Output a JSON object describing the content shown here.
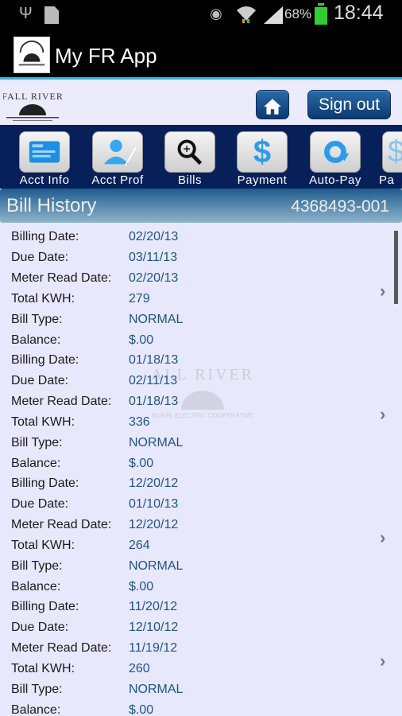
{
  "status_bar": {
    "icons": [
      "usb-icon",
      "no-sim-icon",
      "eye-icon",
      "wifi-icon",
      "signal-icon",
      "battery-charging-icon"
    ],
    "battery_percent": "68%",
    "time": "18:44"
  },
  "action_bar": {
    "title": "My FR App"
  },
  "header": {
    "logo_text": "FALL RIVER",
    "logo_subtext": "RURAL ELECTRIC COOPERATIVE",
    "home_icon": "home-icon",
    "sign_out_label": "Sign out"
  },
  "nav": {
    "items": [
      {
        "label": "Acct Info",
        "icon": "id-card-icon"
      },
      {
        "label": "Acct Prof",
        "icon": "user-profile-icon"
      },
      {
        "label": "Bills",
        "icon": "magnify-document-icon"
      },
      {
        "label": "Payment",
        "icon": "dollar-icon"
      },
      {
        "label": "Auto-Pay",
        "icon": "refresh-icon"
      },
      {
        "label": "Pa",
        "icon": "payment-partial-icon"
      }
    ]
  },
  "section": {
    "title": "Bill History",
    "account_number": "4368493-001"
  },
  "field_labels": {
    "billing_date": "Billing Date:",
    "due_date": "Due Date:",
    "meter_read_date": "Meter Read Date:",
    "total_kwh": "Total KWH:",
    "bill_type": "Bill Type:",
    "balance": "Balance:"
  },
  "bills": [
    {
      "billing_date": "02/20/13",
      "due_date": "03/11/13",
      "meter_read_date": "02/20/13",
      "total_kwh": "279",
      "bill_type": "NORMAL",
      "balance": "$.00"
    },
    {
      "billing_date": "01/18/13",
      "due_date": "02/11/13",
      "meter_read_date": "01/18/13",
      "total_kwh": "336",
      "bill_type": "NORMAL",
      "balance": "$.00"
    },
    {
      "billing_date": "12/20/12",
      "due_date": "01/10/13",
      "meter_read_date": "12/20/12",
      "total_kwh": "264",
      "bill_type": "NORMAL",
      "balance": "$.00"
    },
    {
      "billing_date": "11/20/12",
      "due_date": "12/10/12",
      "meter_read_date": "11/19/12",
      "total_kwh": "260",
      "bill_type": "NORMAL",
      "balance": "$.00"
    }
  ],
  "colors": {
    "accent_blue": "#33b5e5",
    "nav_background": "#08205a",
    "value_text": "#1d5486",
    "page_background": "#e8e8fc"
  }
}
